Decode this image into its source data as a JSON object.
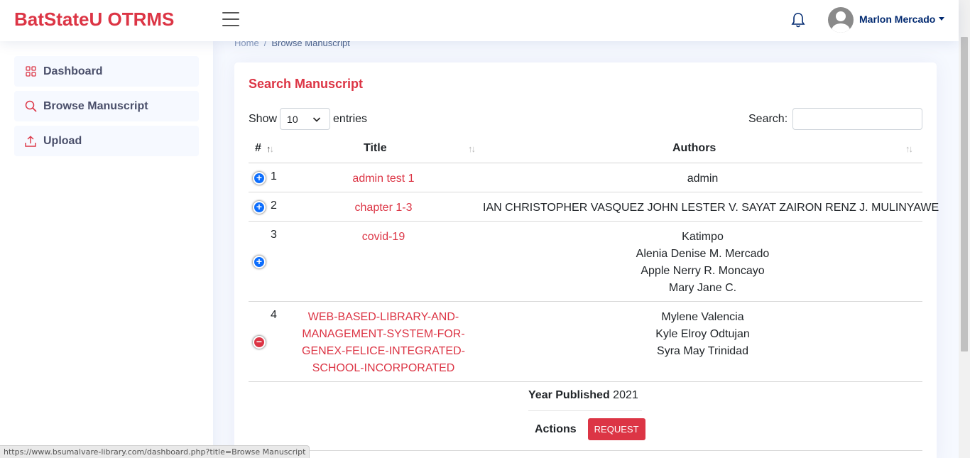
{
  "header": {
    "brand": "BatStateU OTRMS",
    "user_name": "Marlon Mercado"
  },
  "sidebar": {
    "items": [
      {
        "label": "Dashboard",
        "icon": "grid-icon"
      },
      {
        "label": "Browse Manuscript",
        "icon": "search-icon"
      },
      {
        "label": "Upload",
        "icon": "upload-icon"
      }
    ]
  },
  "breadcrumb": {
    "home": "Home",
    "sep": "/",
    "current": "Browse Manuscript"
  },
  "card": {
    "title": "Search Manuscript",
    "show_label": "Show",
    "entries_value": "10",
    "entries_label": "entries",
    "search_label": "Search:",
    "search_value": ""
  },
  "table": {
    "headers": {
      "num": "#",
      "title": "Title",
      "authors": "Authors"
    },
    "rows": [
      {
        "num": "1",
        "title": [
          "admin test 1"
        ],
        "authors": [
          "admin"
        ],
        "expanded": false
      },
      {
        "num": "2",
        "title": [
          "chapter 1-3"
        ],
        "authors": [
          "IAN CHRISTOPHER VASQUEZ JOHN LESTER V. SAYAT ZAIRON RENZ J. MULINYAWE"
        ],
        "expanded": false
      },
      {
        "num": "3",
        "title": [
          "covid-19"
        ],
        "authors": [
          "Katimpo",
          "Alenia Denise M. Mercado",
          "Apple Nerry R. Moncayo",
          "Mary Jane C."
        ],
        "expanded": false
      },
      {
        "num": "4",
        "title": [
          "WEB-BASED-LIBRARY-AND-",
          "MANAGEMENT-SYSTEM-FOR-",
          "GENEX-FELICE-INTEGRATED-",
          "SCHOOL-INCORPORATED"
        ],
        "authors": [
          "Mylene Valencia",
          "Kyle Elroy Odtujan",
          "Syra May Trinidad"
        ],
        "expanded": true
      }
    ],
    "detail": {
      "year_label": "Year Published",
      "year_value": "2021",
      "actions_label": "Actions",
      "request_label": "REQUEST"
    }
  },
  "status_url": "https://www.bsumalvare-library.com/dashboard.php?title=Browse Manuscript",
  "colors": {
    "brand": "#dc3545",
    "nav": "#012970",
    "expand": "#0d6efd",
    "collapse": "#dc3545"
  }
}
